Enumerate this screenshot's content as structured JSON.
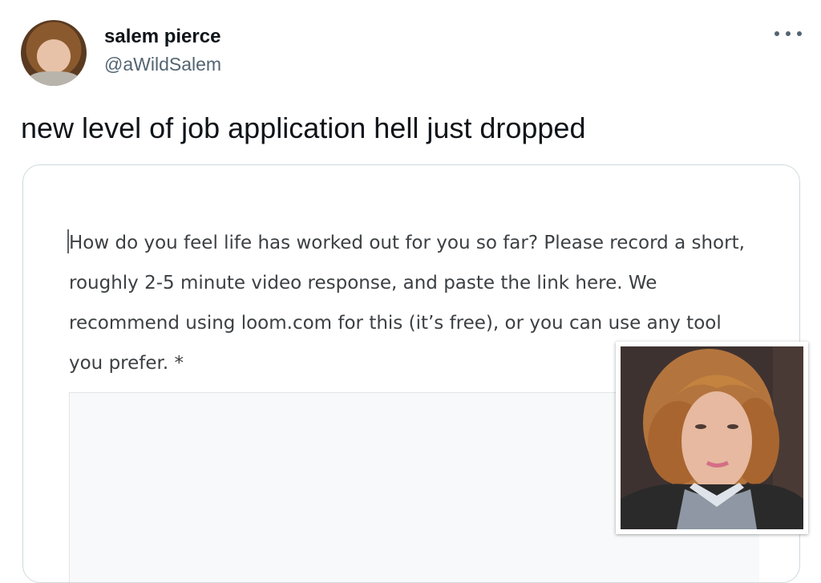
{
  "tweet": {
    "author": {
      "display_name": "salem pierce",
      "handle": "@aWildSalem"
    },
    "menu_icon": "more-horizontal-icon",
    "text": "new level of job application hell just dropped"
  },
  "form": {
    "question": "How do you feel life has worked out for you so far? Please record a short, roughly 2-5 minute video response, and paste the link here. We recommend using loom.com for this (it’s free), or you can use any tool you prefer. *",
    "answer_value": ""
  }
}
